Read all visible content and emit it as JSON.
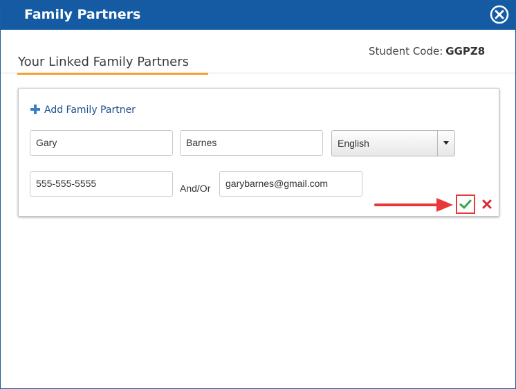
{
  "dialog": {
    "title": "Family Partners",
    "close_icon": "circle-x-icon"
  },
  "section": {
    "tab_label": "Your Linked Family Partners",
    "accent_color": "#f5a030"
  },
  "student_code": {
    "label": "Student Code:",
    "value": "GGPZ8"
  },
  "form": {
    "add_link": "Add Family Partner",
    "first_name": "Gary",
    "last_name": "Barnes",
    "language": "English",
    "phone": "555-555-5555",
    "connector": "And/Or",
    "email": "garybarnes@gmail.com",
    "confirm_icon": "checkmark-icon",
    "cancel_icon": "x-icon"
  },
  "colors": {
    "header": "#155ba3",
    "confirm": "#3aa34a",
    "cancel": "#d9262b",
    "annotation": "#e8383a"
  }
}
